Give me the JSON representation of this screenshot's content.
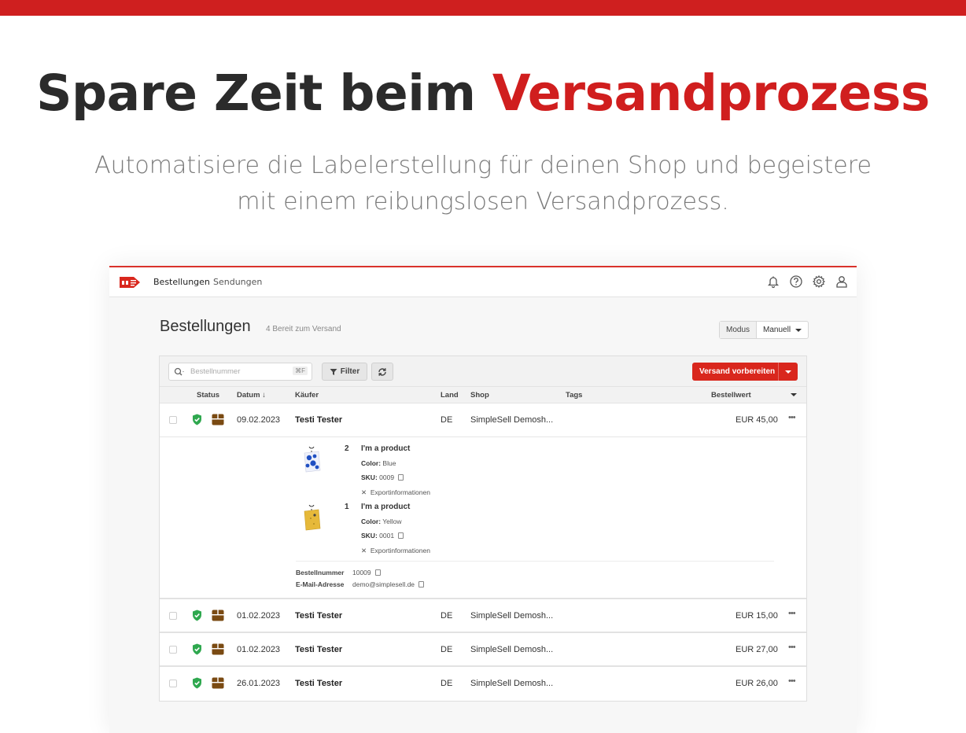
{
  "hero": {
    "title_part1": "Spare Zeit beim ",
    "title_accent": "Versandprozess",
    "subtitle_line1": "Automatisiere die Labelerstellung für deinen Shop und begeistere",
    "subtitle_line2": "mit einem reibungslosen Versandprozess."
  },
  "colors": {
    "brand_red": "#d01e1e",
    "status_green": "#2fa84f",
    "box_brown": "#7a4a12"
  },
  "nav": {
    "items": [
      "Bestellungen",
      "Sendungen"
    ],
    "active": "Bestellungen"
  },
  "header_icons": [
    "bell-icon",
    "help-icon",
    "gear-icon",
    "user-icon"
  ],
  "page": {
    "title": "Bestellungen",
    "subtitle": "4 Bereit zum Versand"
  },
  "mode": {
    "label": "Modus",
    "value": "Manuell"
  },
  "toolbar": {
    "search_placeholder": "Bestellnummer",
    "search_shortcut": "⌘F",
    "filter_label": "Filter",
    "primary_label": "Versand vorbereiten"
  },
  "table": {
    "headers": {
      "status": "Status",
      "date": "Datum ↓",
      "buyer": "Käufer",
      "country": "Land",
      "shop": "Shop",
      "tags": "Tags",
      "value": "Bestellwert"
    },
    "rows": [
      {
        "date": "09.02.2023",
        "buyer": "Testi Tester",
        "country": "DE",
        "shop": "SimpleSell Demosh...",
        "value": "EUR 45,00",
        "more": "•••"
      },
      {
        "date": "01.02.2023",
        "buyer": "Testi Tester",
        "country": "DE",
        "shop": "SimpleSell Demosh...",
        "value": "EUR 15,00",
        "more": "•••"
      },
      {
        "date": "01.02.2023",
        "buyer": "Testi Tester",
        "country": "DE",
        "shop": "SimpleSell Demosh...",
        "value": "EUR 27,00",
        "more": "•••"
      },
      {
        "date": "26.01.2023",
        "buyer": "Testi Tester",
        "country": "DE",
        "shop": "SimpleSell Demosh...",
        "value": "EUR 26,00",
        "more": "•••"
      }
    ]
  },
  "details": {
    "items": [
      {
        "qty": "2",
        "name": "I'm a product",
        "color_label": "Color:",
        "color": "Blue",
        "sku_label": "SKU:",
        "sku": "0009",
        "export": "Exportinformationen"
      },
      {
        "qty": "1",
        "name": "I'm a product",
        "color_label": "Color:",
        "color": "Yellow",
        "sku_label": "SKU:",
        "sku": "0001",
        "export": "Exportinformationen"
      }
    ],
    "order_number_label": "Bestellnummer",
    "order_number": "10009",
    "email_label": "E-Mail-Adresse",
    "email": "demo@simplesell.de"
  }
}
